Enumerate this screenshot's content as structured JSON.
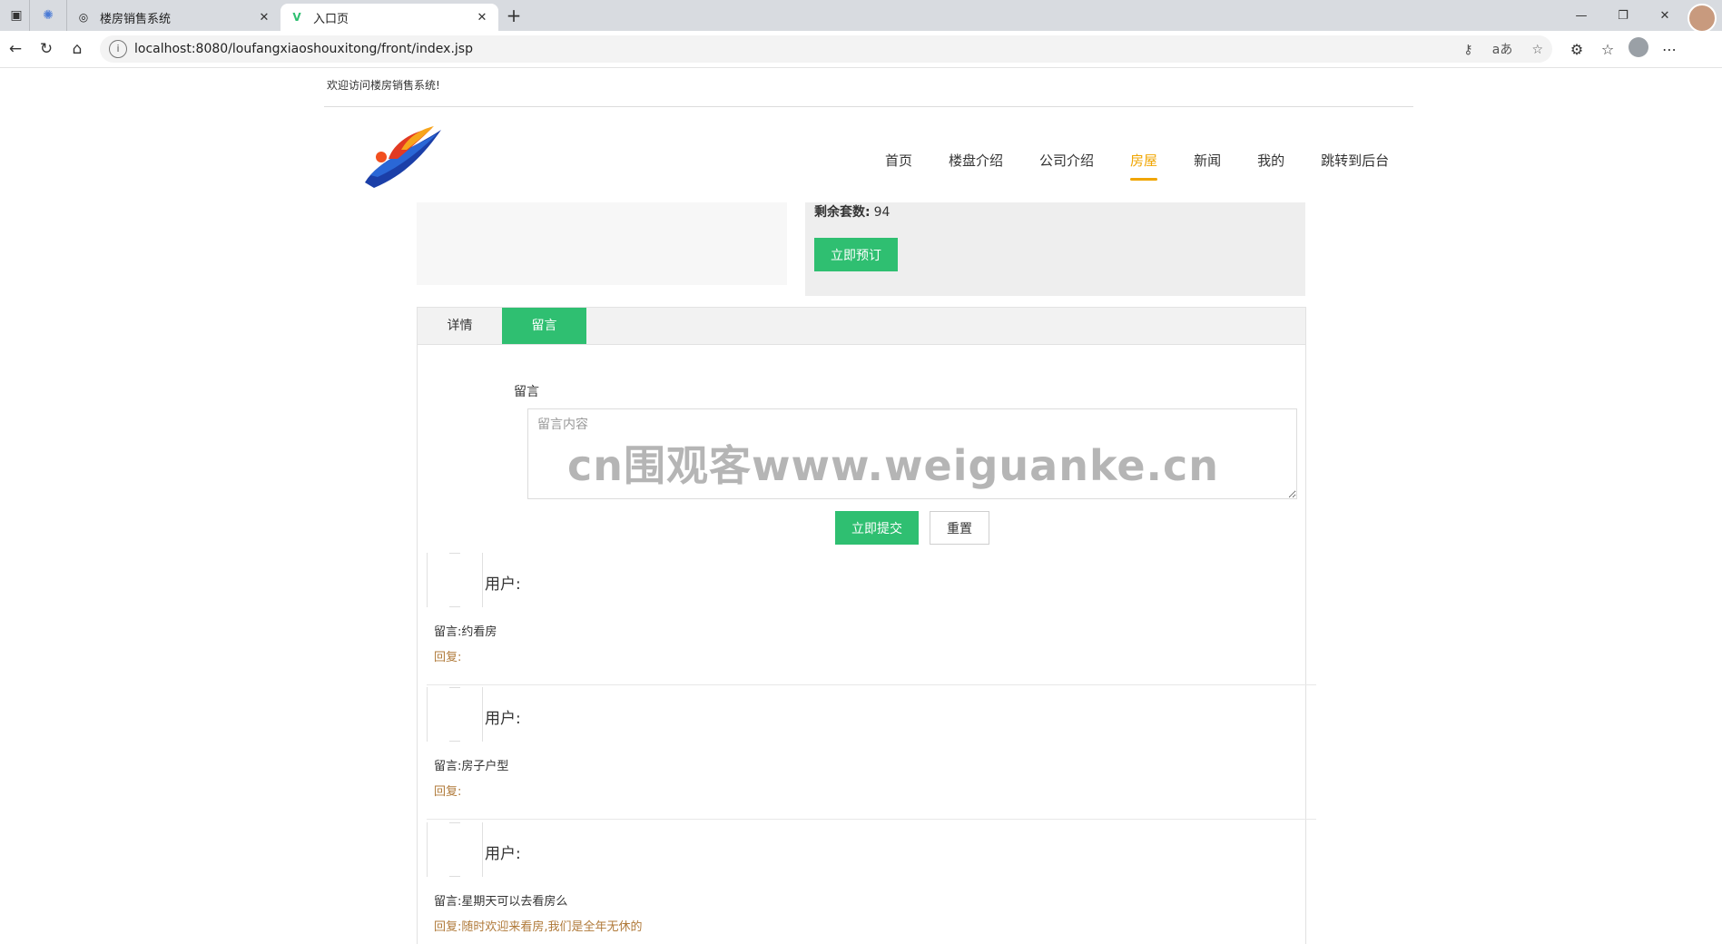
{
  "browser": {
    "tabs": [
      {
        "title": "楼房销售系统",
        "active": false
      },
      {
        "title": "入口页",
        "active": true
      }
    ],
    "url": "localhost:8080/loufangxiaoshouxitong/front/index.jsp"
  },
  "site": {
    "welcome": "欢迎访问楼房销售系统!",
    "nav": [
      "首页",
      "楼盘介绍",
      "公司介绍",
      "房屋",
      "新闻",
      "我的",
      "跳转到后台"
    ],
    "nav_active_index": 3,
    "accent_color": "#f0a500",
    "primary_color": "#2fbf71"
  },
  "house": {
    "remain_label": "剩余套数:",
    "remain_value": "94",
    "book_button": "立即预订"
  },
  "detail_tabs": {
    "items": [
      "详情",
      "留言"
    ],
    "active_index": 1
  },
  "message_form": {
    "label": "留言",
    "placeholder": "留言内容",
    "submit": "立即提交",
    "reset": "重置"
  },
  "watermark": "cn围观客www.weiguanke.cn",
  "comments": [
    {
      "user": "用户:",
      "content": "留言:约看房",
      "reply": "回复:"
    },
    {
      "user": "用户:",
      "content": "留言:房子户型",
      "reply": "回复:"
    },
    {
      "user": "用户:",
      "content": "留言:星期天可以去看房么",
      "reply": "回复:随时欢迎来看房,我们是全年无休的"
    }
  ]
}
